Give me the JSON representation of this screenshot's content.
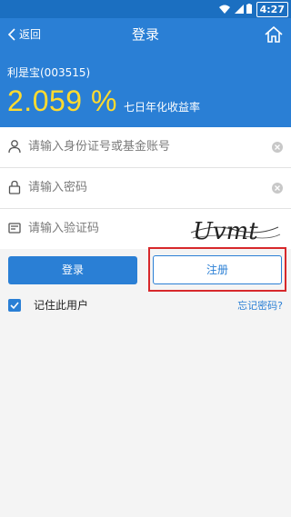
{
  "status_bar": {
    "time": "4:27"
  },
  "header": {
    "back_label": "返回",
    "title": "登录"
  },
  "fund": {
    "name": "利是宝(003515)",
    "rate": "2.059 %",
    "rate_label": "七日年化收益率"
  },
  "form": {
    "account_placeholder": "请输入身份证号或基金账号",
    "password_placeholder": "请输入密码",
    "captcha_placeholder": "请输入验证码",
    "captcha_text": "Uvmt"
  },
  "buttons": {
    "login": "登录",
    "register": "注册"
  },
  "options": {
    "remember_label": "记住此用户",
    "forgot_label": "忘记密码?"
  },
  "colors": {
    "primary": "#2a7fd5",
    "rate": "#ffdb2e",
    "highlight": "#d7282b"
  }
}
